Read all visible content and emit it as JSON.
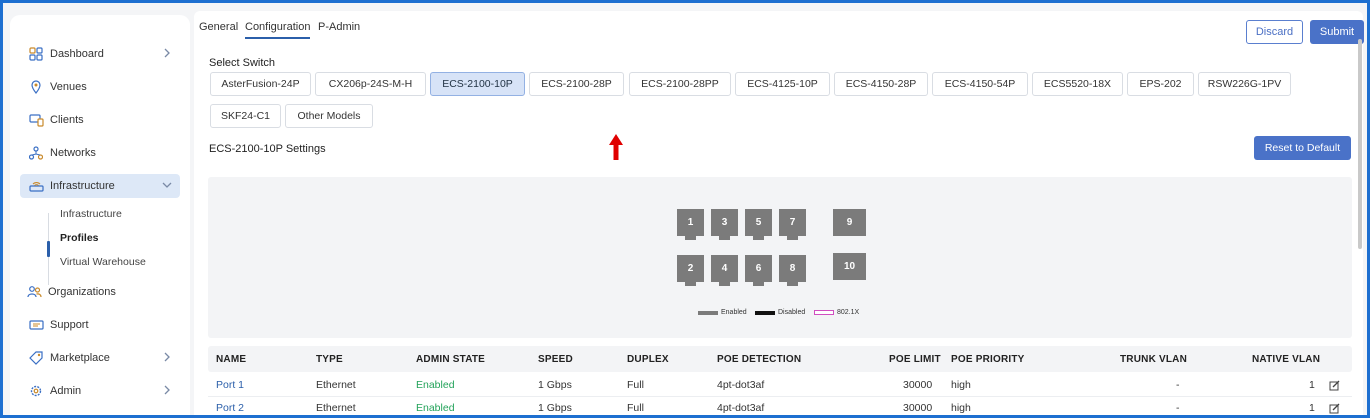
{
  "sidebar": {
    "items": [
      {
        "label": "Dashboard",
        "icon": "grid-icon",
        "chevron": true
      },
      {
        "label": "Venues",
        "icon": "map-pin-icon",
        "chevron": false
      },
      {
        "label": "Clients",
        "icon": "devices-icon",
        "chevron": false
      },
      {
        "label": "Networks",
        "icon": "network-icon",
        "chevron": false
      },
      {
        "label": "Infrastructure",
        "icon": "router-icon",
        "chevron": true,
        "expanded": true
      },
      {
        "label": "Organizations",
        "icon": "users-icon",
        "chevron": false
      },
      {
        "label": "Support",
        "icon": "ticket-icon",
        "chevron": false
      },
      {
        "label": "Marketplace",
        "icon": "tag-icon",
        "chevron": true
      },
      {
        "label": "Admin",
        "icon": "gear-icon",
        "chevron": true
      }
    ],
    "sub_items": [
      "Infrastructure",
      "Profiles",
      "Virtual Warehouse"
    ]
  },
  "tabs": [
    "General",
    "Configuration",
    "P-Admin"
  ],
  "active_tab": "Configuration",
  "actions": {
    "discard": "Discard",
    "submit": "Submit"
  },
  "select_switch": {
    "label": "Select Switch",
    "options": [
      "AsterFusion-24P",
      "CX206p-24S-M-H",
      "ECS-2100-10P",
      "ECS-2100-28P",
      "ECS-2100-28PP",
      "ECS-4125-10P",
      "ECS-4150-28P",
      "ECS-4150-54P",
      "ECS5520-18X",
      "EPS-202",
      "RSW226G-1PV",
      "SKF24-C1",
      "Other Models"
    ],
    "selected": "ECS-2100-10P"
  },
  "settings": {
    "title": "ECS-2100-10P Settings",
    "reset_label": "Reset to Default"
  },
  "ports": {
    "top": [
      "1",
      "3",
      "5",
      "7"
    ],
    "bottom": [
      "2",
      "4",
      "6",
      "8"
    ],
    "sfp": [
      "9",
      "10"
    ]
  },
  "legend": [
    {
      "label": "Enabled",
      "color": "#7b7b7b"
    },
    {
      "label": "Disabled",
      "color": "#111111"
    },
    {
      "label": "802.1X",
      "color": "#d04fc0"
    }
  ],
  "table": {
    "headers": [
      "NAME",
      "TYPE",
      "ADMIN STATE",
      "SPEED",
      "DUPLEX",
      "POE DETECTION",
      "POE LIMIT",
      "POE PRIORITY",
      "TRUNK VLAN",
      "NATIVE VLAN"
    ],
    "rows": [
      [
        "Port 1",
        "Ethernet",
        "Enabled",
        "1 Gbps",
        "Full",
        "4pt-dot3af",
        "30000",
        "high",
        "-",
        "1"
      ],
      [
        "Port 2",
        "Ethernet",
        "Enabled",
        "1 Gbps",
        "Full",
        "4pt-dot3af",
        "30000",
        "high",
        "-",
        "1"
      ]
    ]
  },
  "colors": {
    "accent": "#4a72c8",
    "frame_border": "#1d6fd0",
    "enabled_text": "#23a35a",
    "arrow": "#e00000"
  }
}
